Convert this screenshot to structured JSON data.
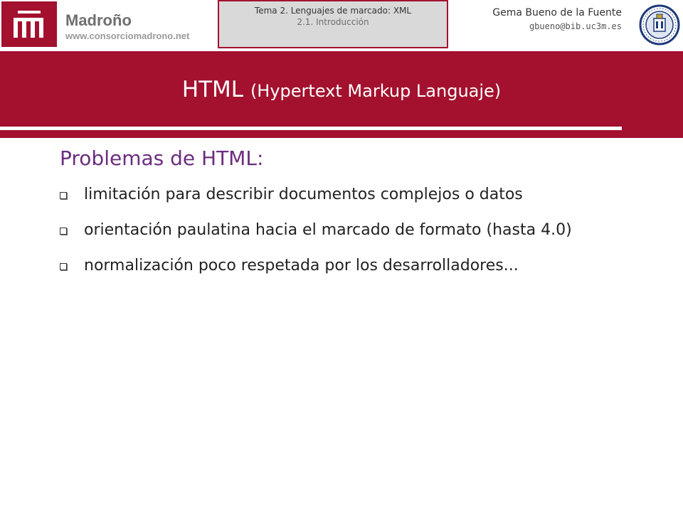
{
  "header": {
    "logo_name": "Madroño",
    "logo_url": "www.consorciomadrono.net",
    "topic_line1": "Tema 2. Lenguajes de marcado: XML",
    "topic_line2": "2.1. Introducción",
    "author_name": "Gema Bueno de la Fuente",
    "author_email": "gbueno@bib.uc3m.es"
  },
  "slide": {
    "title_main": "HTML",
    "title_paren": "(Hypertext Markup Languaje)",
    "heading": "Problemas de HTML:",
    "bullets": [
      "limitación para describir documentos complejos o datos",
      "orientación paulatina hacia el marcado de formato (hasta 4.0)",
      "normalización poco respetada por los desarrolladores..."
    ]
  },
  "colors": {
    "brand_red": "#a3112e",
    "heading_purple": "#6b2d7e"
  },
  "icons": {
    "logo": "madrono-logo-icon",
    "seal": "university-seal-icon",
    "bullet": "square-bullet-icon"
  }
}
